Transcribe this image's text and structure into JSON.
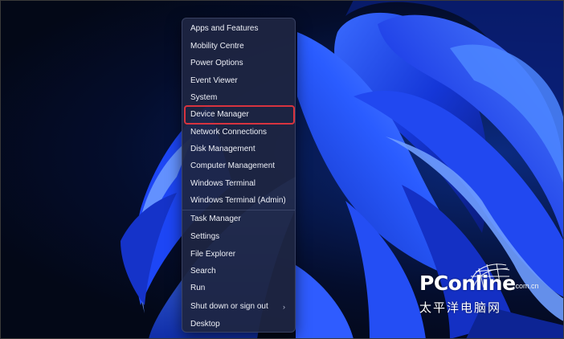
{
  "menu": {
    "items": [
      {
        "label": "Apps and Features"
      },
      {
        "label": "Mobility Centre"
      },
      {
        "label": "Power Options"
      },
      {
        "label": "Event Viewer"
      },
      {
        "label": "System"
      },
      {
        "label": "Device Manager",
        "highlighted": true
      },
      {
        "label": "Network Connections"
      },
      {
        "label": "Disk Management"
      },
      {
        "label": "Computer Management"
      },
      {
        "label": "Windows Terminal"
      },
      {
        "label": "Windows Terminal (Admin)"
      },
      {
        "label": "Task Manager"
      },
      {
        "label": "Settings"
      },
      {
        "label": "File Explorer"
      },
      {
        "label": "Search"
      },
      {
        "label": "Run"
      },
      {
        "label": "Shut down or sign out",
        "has_submenu": true
      },
      {
        "label": "Desktop"
      }
    ],
    "highlight_color": "#d8333f"
  },
  "watermark": {
    "brand": "PConline",
    "domain": ".com.cn",
    "chinese": "太平洋电脑网"
  },
  "colors": {
    "menu_background": "#1e2542",
    "menu_text": "#eef0f7",
    "wallpaper_accent": "#1e4fff"
  },
  "icons": {
    "submenu_chevron": "chevron-right-icon"
  }
}
